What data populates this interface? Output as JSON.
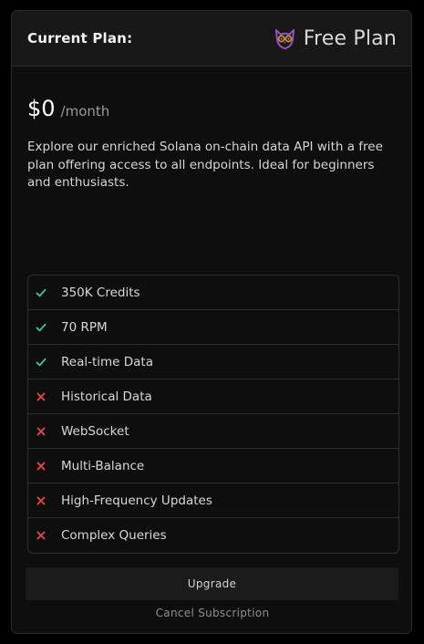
{
  "header": {
    "label": "Current Plan:",
    "plan_name": "Free Plan",
    "plan_icon": "owl-icon"
  },
  "pricing": {
    "amount": "$0",
    "period": "/month"
  },
  "description": "Explore our enriched Solana on-chain data API with a free plan offering access to all endpoints. Ideal for beginners and enthusiasts.",
  "features": [
    {
      "label": "350K Credits",
      "included": true
    },
    {
      "label": "70 RPM",
      "included": true
    },
    {
      "label": "Real-time Data",
      "included": true
    },
    {
      "label": "Historical Data",
      "included": false
    },
    {
      "label": "WebSocket",
      "included": false
    },
    {
      "label": "Multi-Balance",
      "included": false
    },
    {
      "label": "High-Frequency Updates",
      "included": false
    },
    {
      "label": "Complex Queries",
      "included": false
    }
  ],
  "actions": {
    "upgrade_label": "Upgrade",
    "cancel_label": "Cancel Subscription"
  },
  "colors": {
    "check": "#3fbf8a",
    "cross": "#e04848",
    "owl_outline": "#9b4fc4",
    "owl_eyes": "#c8933a"
  }
}
